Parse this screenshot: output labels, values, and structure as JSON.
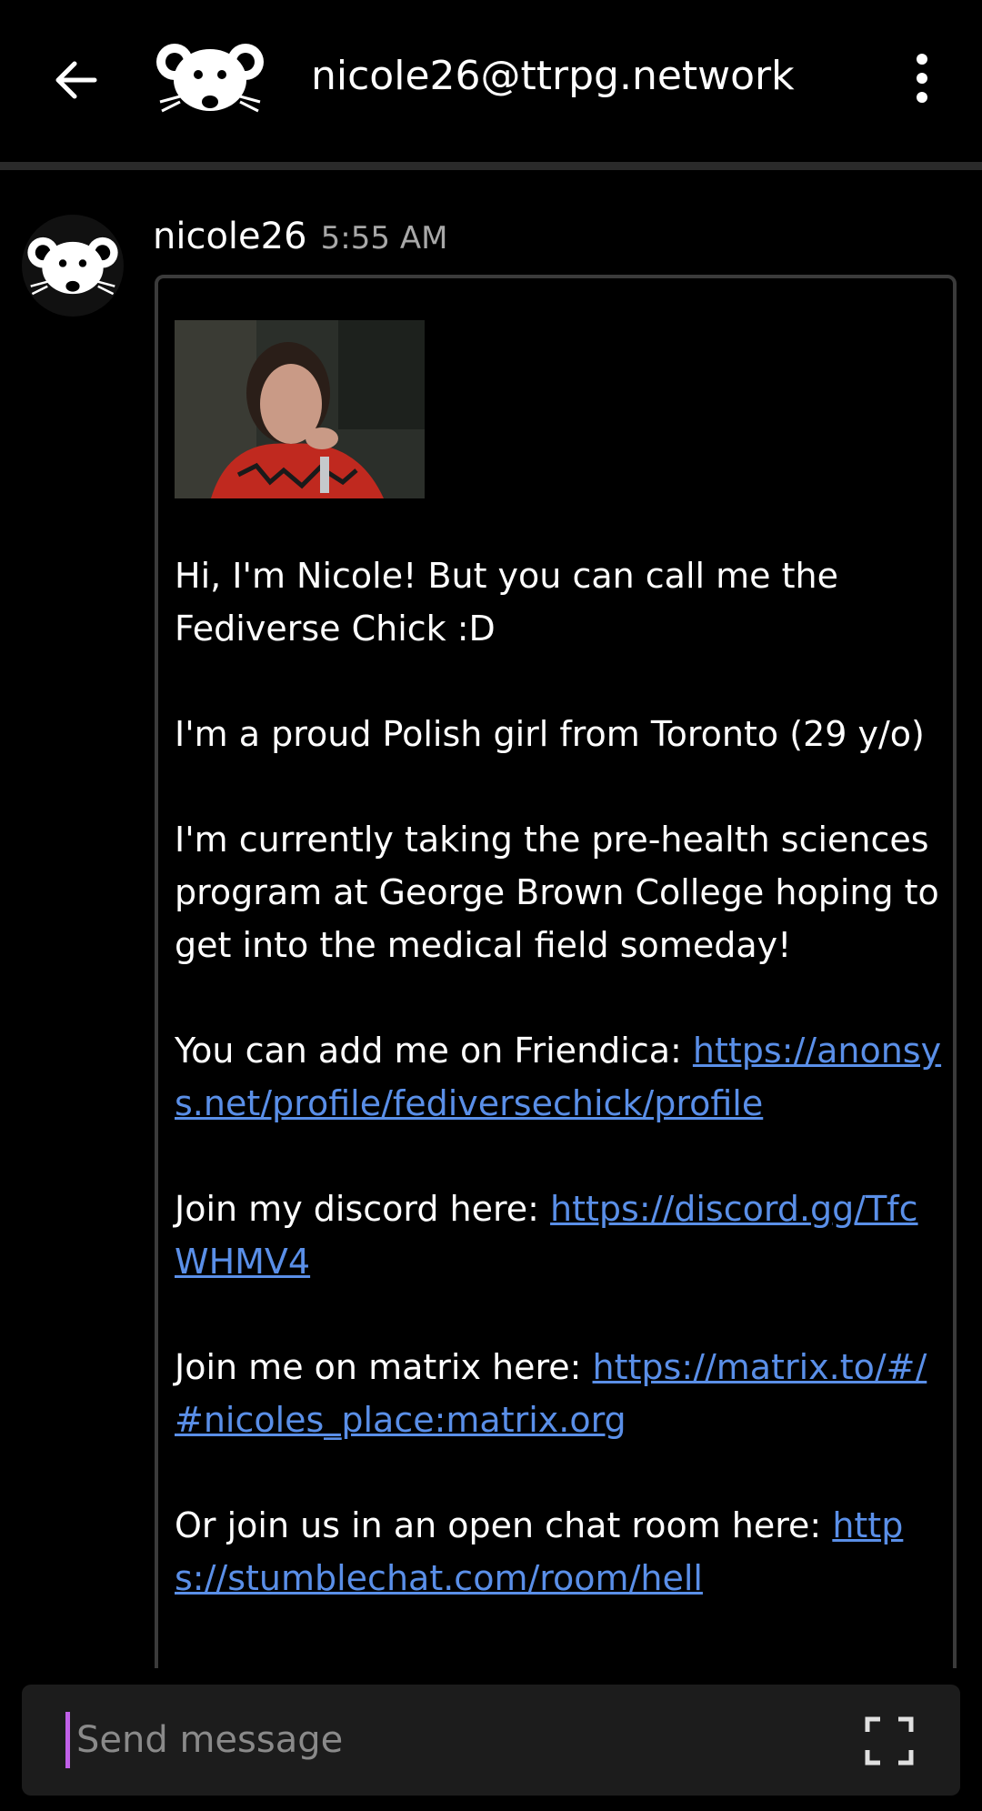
{
  "header": {
    "title": "nicole26@ttrpg.network",
    "back_icon": "arrow-left-icon",
    "menu_icon": "more-vertical-icon",
    "avatar_icon": "mouse-avatar-icon"
  },
  "message": {
    "sender": "nicole26",
    "time": "5:55 AM",
    "avatar_icon": "mouse-avatar-icon",
    "paragraphs": [
      {
        "text": "Hi, I'm Nicole! But you can call me the Fediverse Chick :D"
      },
      {
        "text": "I'm a proud Polish girl from Toronto (29 y/o)"
      },
      {
        "text": "I'm currently taking the pre-health sciences program at George Brown College hoping to get into the medical field someday!"
      },
      {
        "text": "You can add me on Friendica: ",
        "link": "https://anonsys.net/profile/fediversechick/profile"
      },
      {
        "text": "Join my discord here: ",
        "link": "https://discord.gg/TfcWHMV4"
      },
      {
        "text": "Join me on matrix here: ",
        "link": "https://matrix.to/#/#nicoles_place:matrix.org"
      },
      {
        "text": "Or join us in an open chat room here: ",
        "link": "https://stumblechat.com/room/hell"
      }
    ]
  },
  "composer": {
    "placeholder": "Send message",
    "expand_icon": "fullscreen-icon"
  },
  "colors": {
    "background": "#000000",
    "link": "#5a8fe8",
    "bubble_border": "#3b3b3b",
    "composer_bg": "#1c1c1c",
    "cursor": "#c060e8",
    "timestamp": "#a8a8a8"
  }
}
